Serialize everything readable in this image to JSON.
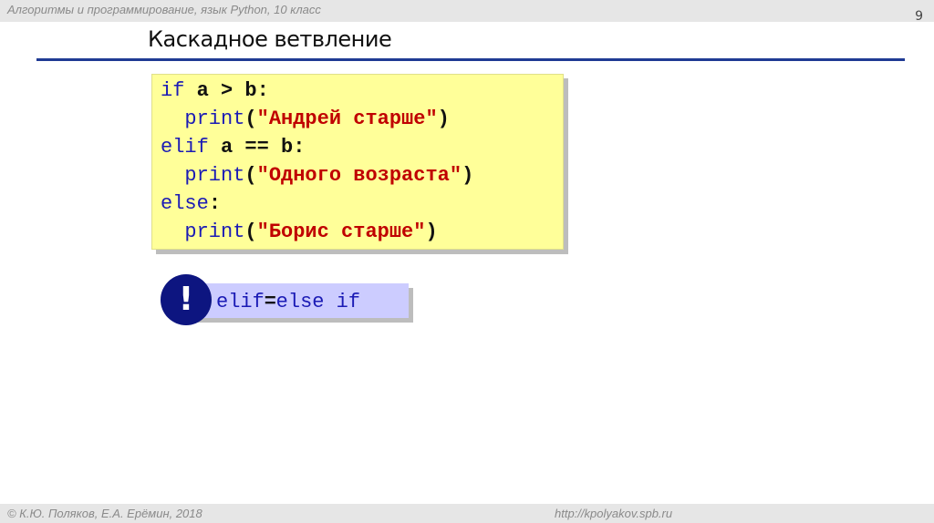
{
  "header": {
    "course_title": "Алгоритмы и программирование, язык Python, 10 класс",
    "page_number": "9"
  },
  "slide": {
    "title": "Каскадное ветвление"
  },
  "code": {
    "line1": {
      "kw": "if",
      "rest": " a > b:"
    },
    "line2": {
      "indent": "  ",
      "func": "print",
      "open": "(",
      "str": "\"Андрей старше\"",
      "close": ")"
    },
    "line3": {
      "kw": "elif",
      "rest": " a == b:"
    },
    "line4": {
      "indent": "  ",
      "func": "print",
      "open": "(",
      "str": "\"Одного возраста\"",
      "close": ")"
    },
    "line5": {
      "kw": "else",
      "rest": ":"
    },
    "line6": {
      "indent": "  ",
      "func": "print",
      "open": "(",
      "str": "\"Борис старше\"",
      "close": ")"
    }
  },
  "note": {
    "icon": "exclamation-icon",
    "icon_glyph": "!",
    "left": "elif",
    "equals": "=",
    "right": "else if"
  },
  "footer": {
    "copyright": "© К.Ю. Поляков, Е.А. Ерёмин, 2018",
    "url": "http://kpolyakov.spb.ru"
  }
}
